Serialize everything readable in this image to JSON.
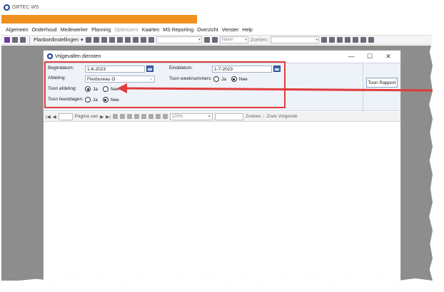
{
  "app": {
    "title": "ORTEC WS"
  },
  "menu": [
    "Algemeen",
    "Onderhoud",
    "Medewerker",
    "Planning",
    "Optimizers",
    "Kaarten",
    "MS Reporting",
    "Overzicht",
    "Venster",
    "Help"
  ],
  "toolbar": {
    "planbord_label": "Planbordinstellingen",
    "naam_label": "Naam",
    "zoeken_label": "Zoeken:"
  },
  "dialog": {
    "title": "Vrijgevallen diensten",
    "begindatum_label": "Begindatum:",
    "begindatum_value": "1-6-2023",
    "einddatum_label": "Einddatum:",
    "einddatum_value": "1-7-2023",
    "afdeling_label": "Afdeling:",
    "afdeling_value": "Flexbureau O",
    "toon_weeknummers_label": "Toon weeknummers:",
    "toon_afdeling_label": "Toon afdeling:",
    "toon_feestdagen_label": "Toon feestdagen:",
    "ja": "Ja",
    "nee": "Nee",
    "toon_rapport": "Toon Rapport"
  },
  "viewer": {
    "pagina_van": "Pagina van",
    "zoom": "100%",
    "zoeken": "Zoeken",
    "zoek_volgende": "Zoek Volgende"
  },
  "colors": {
    "accent_orange": "#f0901f",
    "highlight_red": "#e03c3c",
    "brand_blue": "#1f3d8a"
  }
}
